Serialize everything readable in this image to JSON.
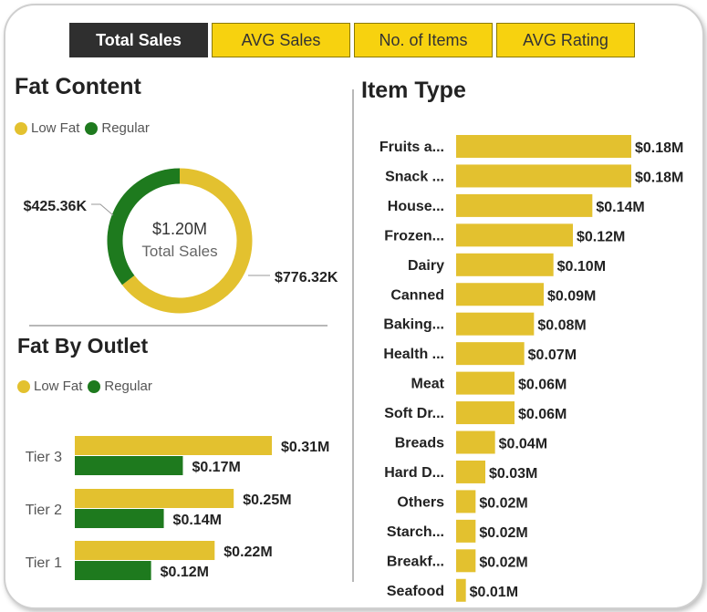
{
  "tabs": [
    {
      "label": "Total Sales",
      "active": true
    },
    {
      "label": "AVG Sales",
      "active": false
    },
    {
      "label": "No. of Items",
      "active": false
    },
    {
      "label": "AVG Rating",
      "active": false
    }
  ],
  "colors": {
    "low_fat": "#e3c12f",
    "regular": "#1e7a1e"
  },
  "fat_content": {
    "title": "Fat Content",
    "legend": [
      "Low Fat",
      "Regular"
    ],
    "center_value": "$1.20M",
    "center_label": "Total Sales",
    "label_low_fat": "$776.32K",
    "label_regular": "$425.36K"
  },
  "fat_by_outlet": {
    "title": "Fat By Outlet",
    "legend": [
      "Low Fat",
      "Regular"
    ],
    "labels": {
      "tier3_low": "$0.31M",
      "tier3_reg": "$0.17M",
      "tier2_low": "$0.25M",
      "tier2_reg": "$0.14M",
      "tier1_low": "$0.22M",
      "tier1_reg": "$0.12M"
    }
  },
  "item_type": {
    "title": "Item Type"
  },
  "chart_data": [
    {
      "type": "pie",
      "title": "Fat Content",
      "categories": [
        "Low Fat",
        "Regular"
      ],
      "values": [
        776.32,
        425.36
      ],
      "unit": "K",
      "center_value": "$1.20M",
      "center_label": "Total Sales",
      "legend": "top-left"
    },
    {
      "type": "bar",
      "title": "Fat By Outlet",
      "orientation": "horizontal",
      "categories": [
        "Tier 3",
        "Tier 2",
        "Tier 1"
      ],
      "series": [
        {
          "name": "Low Fat",
          "values": [
            0.31,
            0.25,
            0.22
          ]
        },
        {
          "name": "Regular",
          "values": [
            0.17,
            0.14,
            0.12
          ]
        }
      ],
      "legend": "top-left"
    },
    {
      "type": "bar",
      "title": "Item Type",
      "orientation": "horizontal",
      "categories": [
        "Fruits a...",
        "Snack ...",
        "House...",
        "Frozen...",
        "Dairy",
        "Canned",
        "Baking...",
        "Health ...",
        "Meat",
        "Soft Dr...",
        "Breads",
        "Hard D...",
        "Others",
        "Starch...",
        "Breakf...",
        "Seafood"
      ],
      "values": [
        0.18,
        0.18,
        0.14,
        0.12,
        0.1,
        0.09,
        0.08,
        0.07,
        0.06,
        0.06,
        0.04,
        0.03,
        0.02,
        0.02,
        0.02,
        0.01
      ],
      "value_labels": [
        "$0.18M",
        "$0.18M",
        "$0.14M",
        "$0.12M",
        "$0.10M",
        "$0.09M",
        "$0.08M",
        "$0.07M",
        "$0.06M",
        "$0.06M",
        "$0.04M",
        "$0.03M",
        "$0.02M",
        "$0.02M",
        "$0.02M",
        "$0.01M"
      ]
    }
  ]
}
